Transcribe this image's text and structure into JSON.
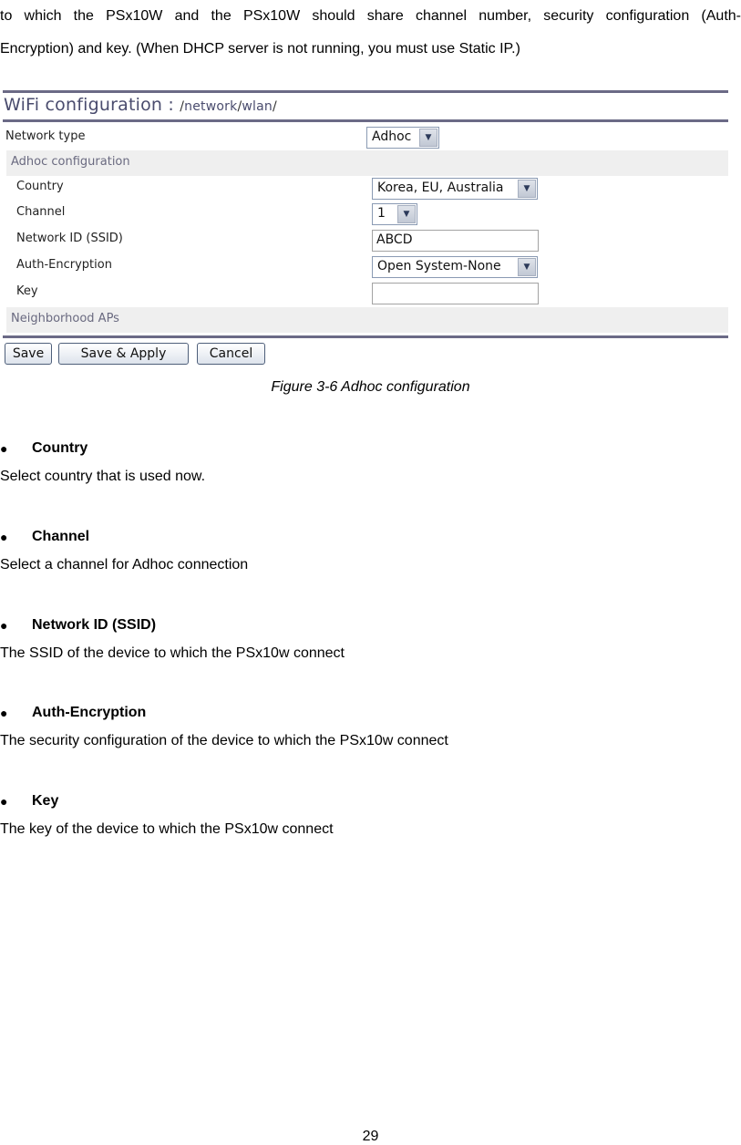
{
  "intro": {
    "line1": "to which the PSx10W and the PSx10W should share channel number, security configuration (Auth-",
    "line2": "Encryption) and key. (When DHCP server is not running, you must use Static IP.)"
  },
  "figure": {
    "title": "WiFi configuration",
    "path_sep": " : ",
    "path": [
      "/",
      "network",
      "/",
      "wlan",
      "/"
    ],
    "network_type": {
      "label": "Network type",
      "value": "Adhoc"
    },
    "adhoc_section": "Adhoc configuration",
    "fields": {
      "country": {
        "label": "Country",
        "value": "Korea, EU, Australia"
      },
      "channel": {
        "label": "Channel",
        "value": "1"
      },
      "ssid": {
        "label": "Network ID (SSID)",
        "value": "ABCD"
      },
      "auth": {
        "label": "Auth-Encryption",
        "value": "Open System-None"
      },
      "key": {
        "label": "Key",
        "value": ""
      }
    },
    "neighborhood_section": "Neighborhood APs",
    "buttons": {
      "save": "Save",
      "save_apply": "Save & Apply",
      "cancel": "Cancel"
    },
    "dropdown_glyph": "▼"
  },
  "caption": "Figure 3-6 Adhoc configuration",
  "bullet_glyph": "●",
  "items": [
    {
      "name": "Country",
      "desc": "Select country that is used now."
    },
    {
      "name": "Channel",
      "desc": "Select a channel for Adhoc connection"
    },
    {
      "name": "Network ID (SSID)",
      "desc": "The SSID of the device to which the PSx10w connect"
    },
    {
      "name": "Auth-Encryption",
      "desc": "The security configuration of the device to which the PSx10w connect"
    },
    {
      "name": "Key",
      "desc": "The key of the device to which the PSx10w connect"
    }
  ],
  "page_number": "29"
}
